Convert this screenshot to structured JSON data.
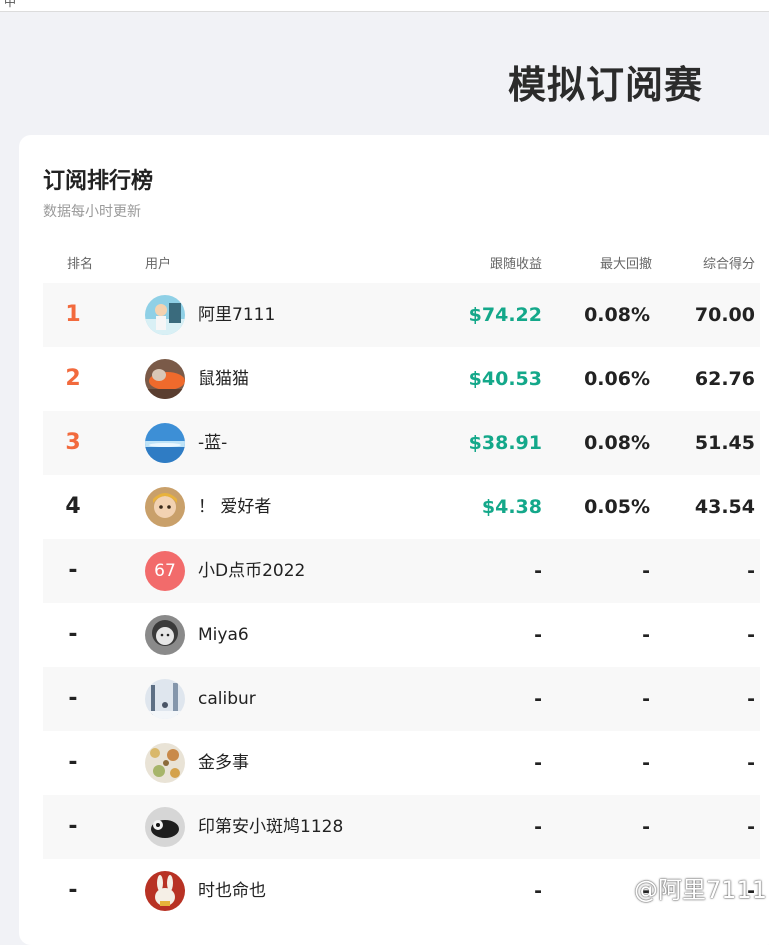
{
  "browser": {
    "tab_glyph": "中"
  },
  "page": {
    "title": "模拟订阅赛"
  },
  "leaderboard": {
    "title": "订阅排行榜",
    "subtitle": "数据每小时更新",
    "columns": {
      "rank": "排名",
      "user": "用户",
      "follow_return": "跟随收益",
      "max_drawdown": "最大回撤",
      "score": "综合得分"
    },
    "rows": [
      {
        "rank": "1",
        "name": "阿里7111",
        "follow_return": "$74.22",
        "max_drawdown": "0.08%",
        "score": "70.00"
      },
      {
        "rank": "2",
        "name": "鼠猫猫",
        "follow_return": "$40.53",
        "max_drawdown": "0.06%",
        "score": "62.76"
      },
      {
        "rank": "3",
        "name": "-蓝-",
        "follow_return": "$38.91",
        "max_drawdown": "0.08%",
        "score": "51.45"
      },
      {
        "rank": "4",
        "name": "！ 爱好者",
        "follow_return": "$4.38",
        "max_drawdown": "0.05%",
        "score": "43.54"
      },
      {
        "rank": "-",
        "name": "小D点币2022",
        "avatar_text": "67",
        "follow_return": "-",
        "max_drawdown": "-",
        "score": "-"
      },
      {
        "rank": "-",
        "name": "Miya6",
        "follow_return": "-",
        "max_drawdown": "-",
        "score": "-"
      },
      {
        "rank": "-",
        "name": "calibur",
        "follow_return": "-",
        "max_drawdown": "-",
        "score": "-"
      },
      {
        "rank": "-",
        "name": "金多事",
        "follow_return": "-",
        "max_drawdown": "-",
        "score": "-"
      },
      {
        "rank": "-",
        "name": "印第安小斑鸠1128",
        "follow_return": "-",
        "max_drawdown": "-",
        "score": "-"
      },
      {
        "rank": "-",
        "name": "时也命也",
        "follow_return": "-",
        "max_drawdown": "-",
        "score": "-"
      }
    ]
  },
  "watermark": {
    "text": "@阿里7111",
    "icon": "app-logo-icon"
  },
  "colors": {
    "top_rank": "#f26a3d",
    "return_positive": "#14a88a",
    "number_avatar": "#f26b6b"
  }
}
